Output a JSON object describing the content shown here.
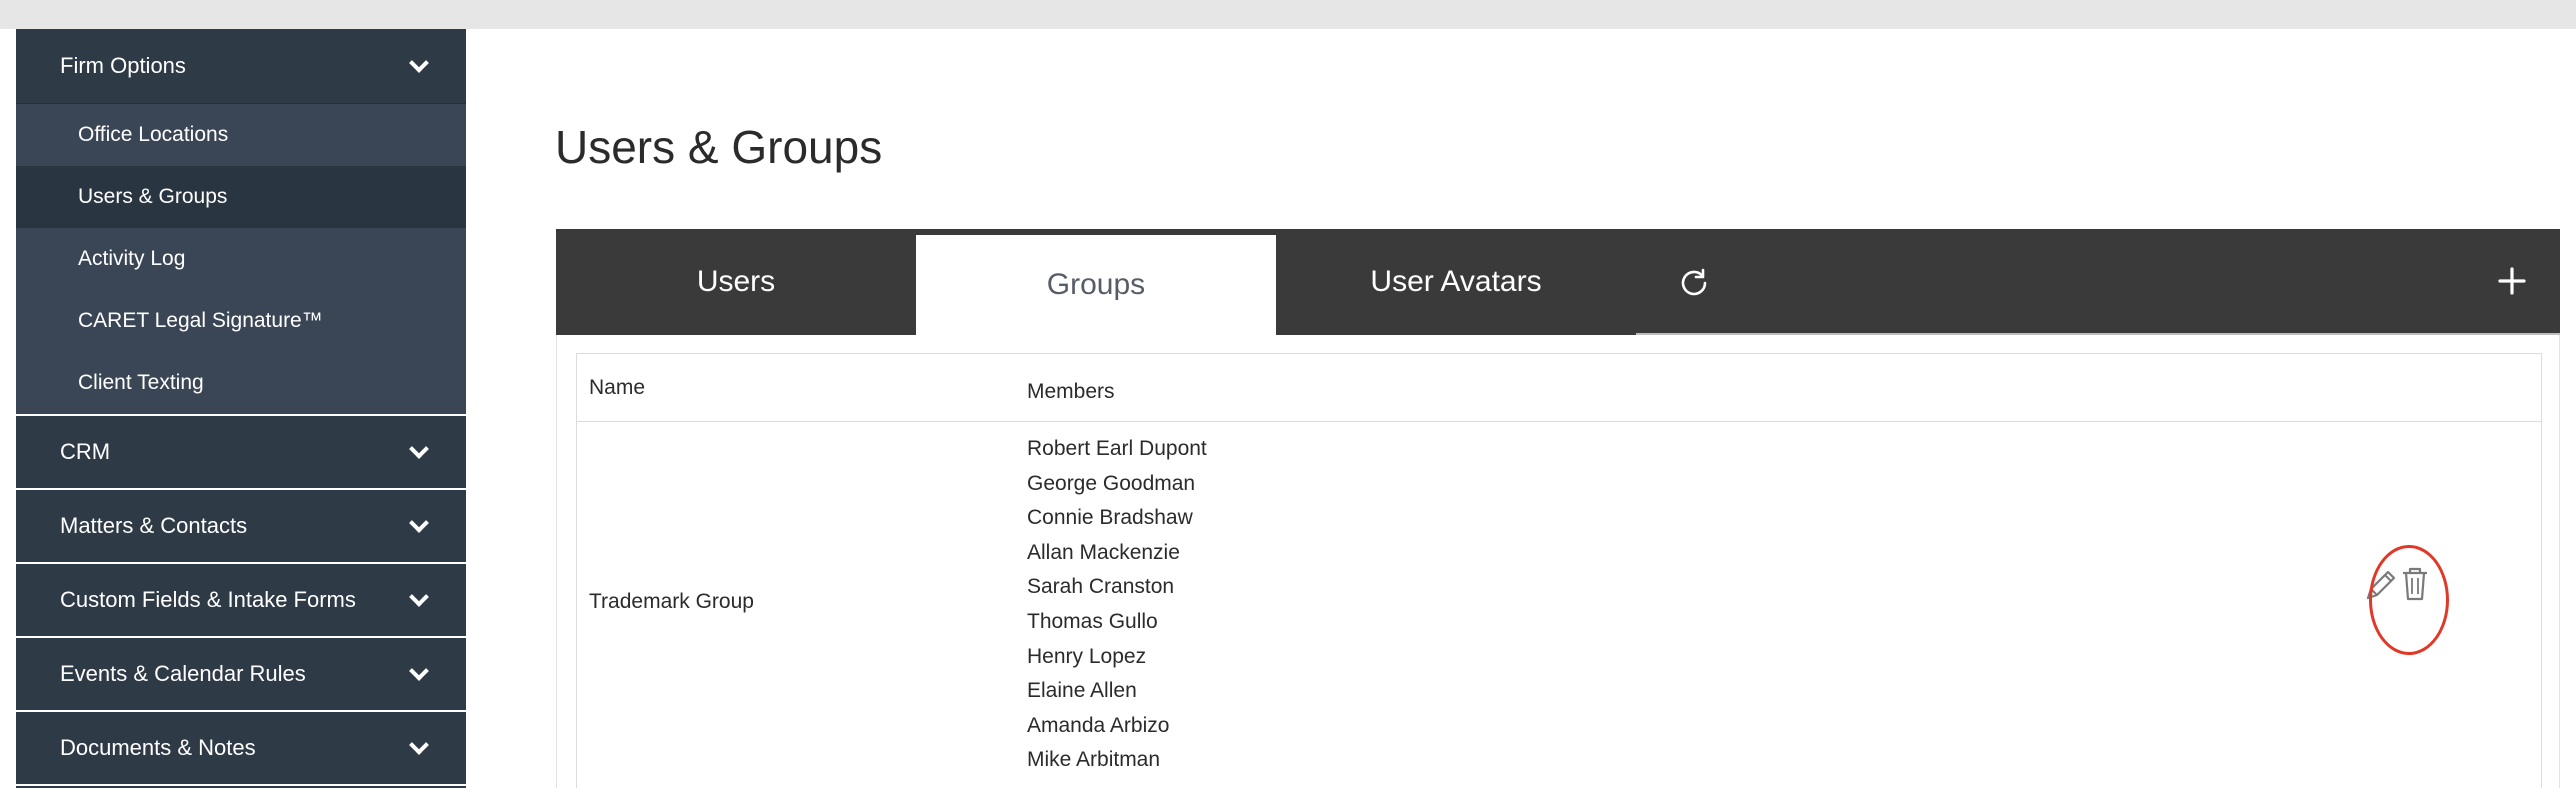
{
  "sidebar": {
    "firm_options": {
      "label": "Firm Options",
      "items": [
        {
          "label": "Office Locations"
        },
        {
          "label": "Users & Groups"
        },
        {
          "label": "Activity Log"
        },
        {
          "label": "CARET Legal Signature™"
        },
        {
          "label": "Client Texting"
        }
      ]
    },
    "sections": [
      {
        "label": "CRM"
      },
      {
        "label": "Matters & Contacts"
      },
      {
        "label": "Custom Fields & Intake Forms"
      },
      {
        "label": "Events & Calendar Rules"
      },
      {
        "label": "Documents & Notes"
      }
    ]
  },
  "page": {
    "title": "Users & Groups"
  },
  "tabs": {
    "users": "Users",
    "groups": "Groups",
    "avatars": "User Avatars"
  },
  "icons": {
    "refresh": "refresh-icon",
    "add": "plus-icon",
    "edit": "pencil-icon",
    "delete": "trash-icon",
    "expand": "chevron-down-icon"
  },
  "colors": {
    "sidebar": "#2f3a47",
    "sidebar_sub": "#3a4655",
    "tabbar": "#3a3a3a",
    "highlight": "#e0392a"
  },
  "table": {
    "headers": {
      "name": "Name",
      "members": "Members"
    },
    "rows": [
      {
        "name": "Trademark Group",
        "members": [
          "Robert Earl Dupont",
          "George Goodman",
          "Connie Bradshaw",
          "Allan Mackenzie",
          "Sarah Cranston",
          "Thomas Gullo",
          "Henry Lopez",
          "Elaine Allen",
          "Amanda Arbizo",
          "Mike Arbitman"
        ]
      }
    ]
  }
}
